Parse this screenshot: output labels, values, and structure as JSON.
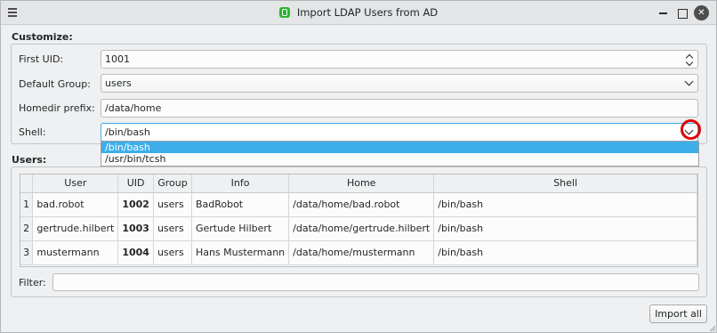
{
  "window": {
    "title": "Import LDAP Users from AD"
  },
  "customize": {
    "heading": "Customize:",
    "first_uid_label": "First UID:",
    "first_uid_value": "1001",
    "default_group_label": "Default Group:",
    "default_group_value": "users",
    "homedir_label": "Homedir prefix:",
    "homedir_value": "/data/home",
    "shell_label": "Shell:",
    "shell_value": "/bin/bash",
    "shell_options": [
      "/bin/bash",
      "/usr/bin/tcsh"
    ],
    "shell_selected_index": 0
  },
  "users": {
    "heading": "Users:",
    "columns": [
      "User",
      "UID",
      "Group",
      "Info",
      "Home",
      "Shell"
    ],
    "rows": [
      {
        "num": "1",
        "user": "bad.robot",
        "uid": "1002",
        "group": "users",
        "info": "BadRobot",
        "home": "/data/home/bad.robot",
        "shell": "/bin/bash"
      },
      {
        "num": "2",
        "user": "gertrude.hilbert",
        "uid": "1003",
        "group": "users",
        "info": "Gertude Hilbert",
        "home": "/data/home/gertrude.hilbert",
        "shell": "/bin/bash"
      },
      {
        "num": "3",
        "user": "mustermann",
        "uid": "1004",
        "group": "users",
        "info": "Hans Mustermann",
        "home": "/data/home/mustermann",
        "shell": "/bin/bash"
      }
    ],
    "filter_label": "Filter:",
    "filter_value": ""
  },
  "buttons": {
    "import_all": "Import all"
  },
  "colors": {
    "accent": "#3daee9",
    "highlight_circle": "#e00000",
    "app_logo": "#2db52d"
  },
  "icons": [
    "window-menu-icon",
    "app-logo-icon",
    "minimize-icon",
    "maximize-icon",
    "close-icon",
    "spin-arrows-icon",
    "chevron-down-icon",
    "resize-grip-icon"
  ]
}
